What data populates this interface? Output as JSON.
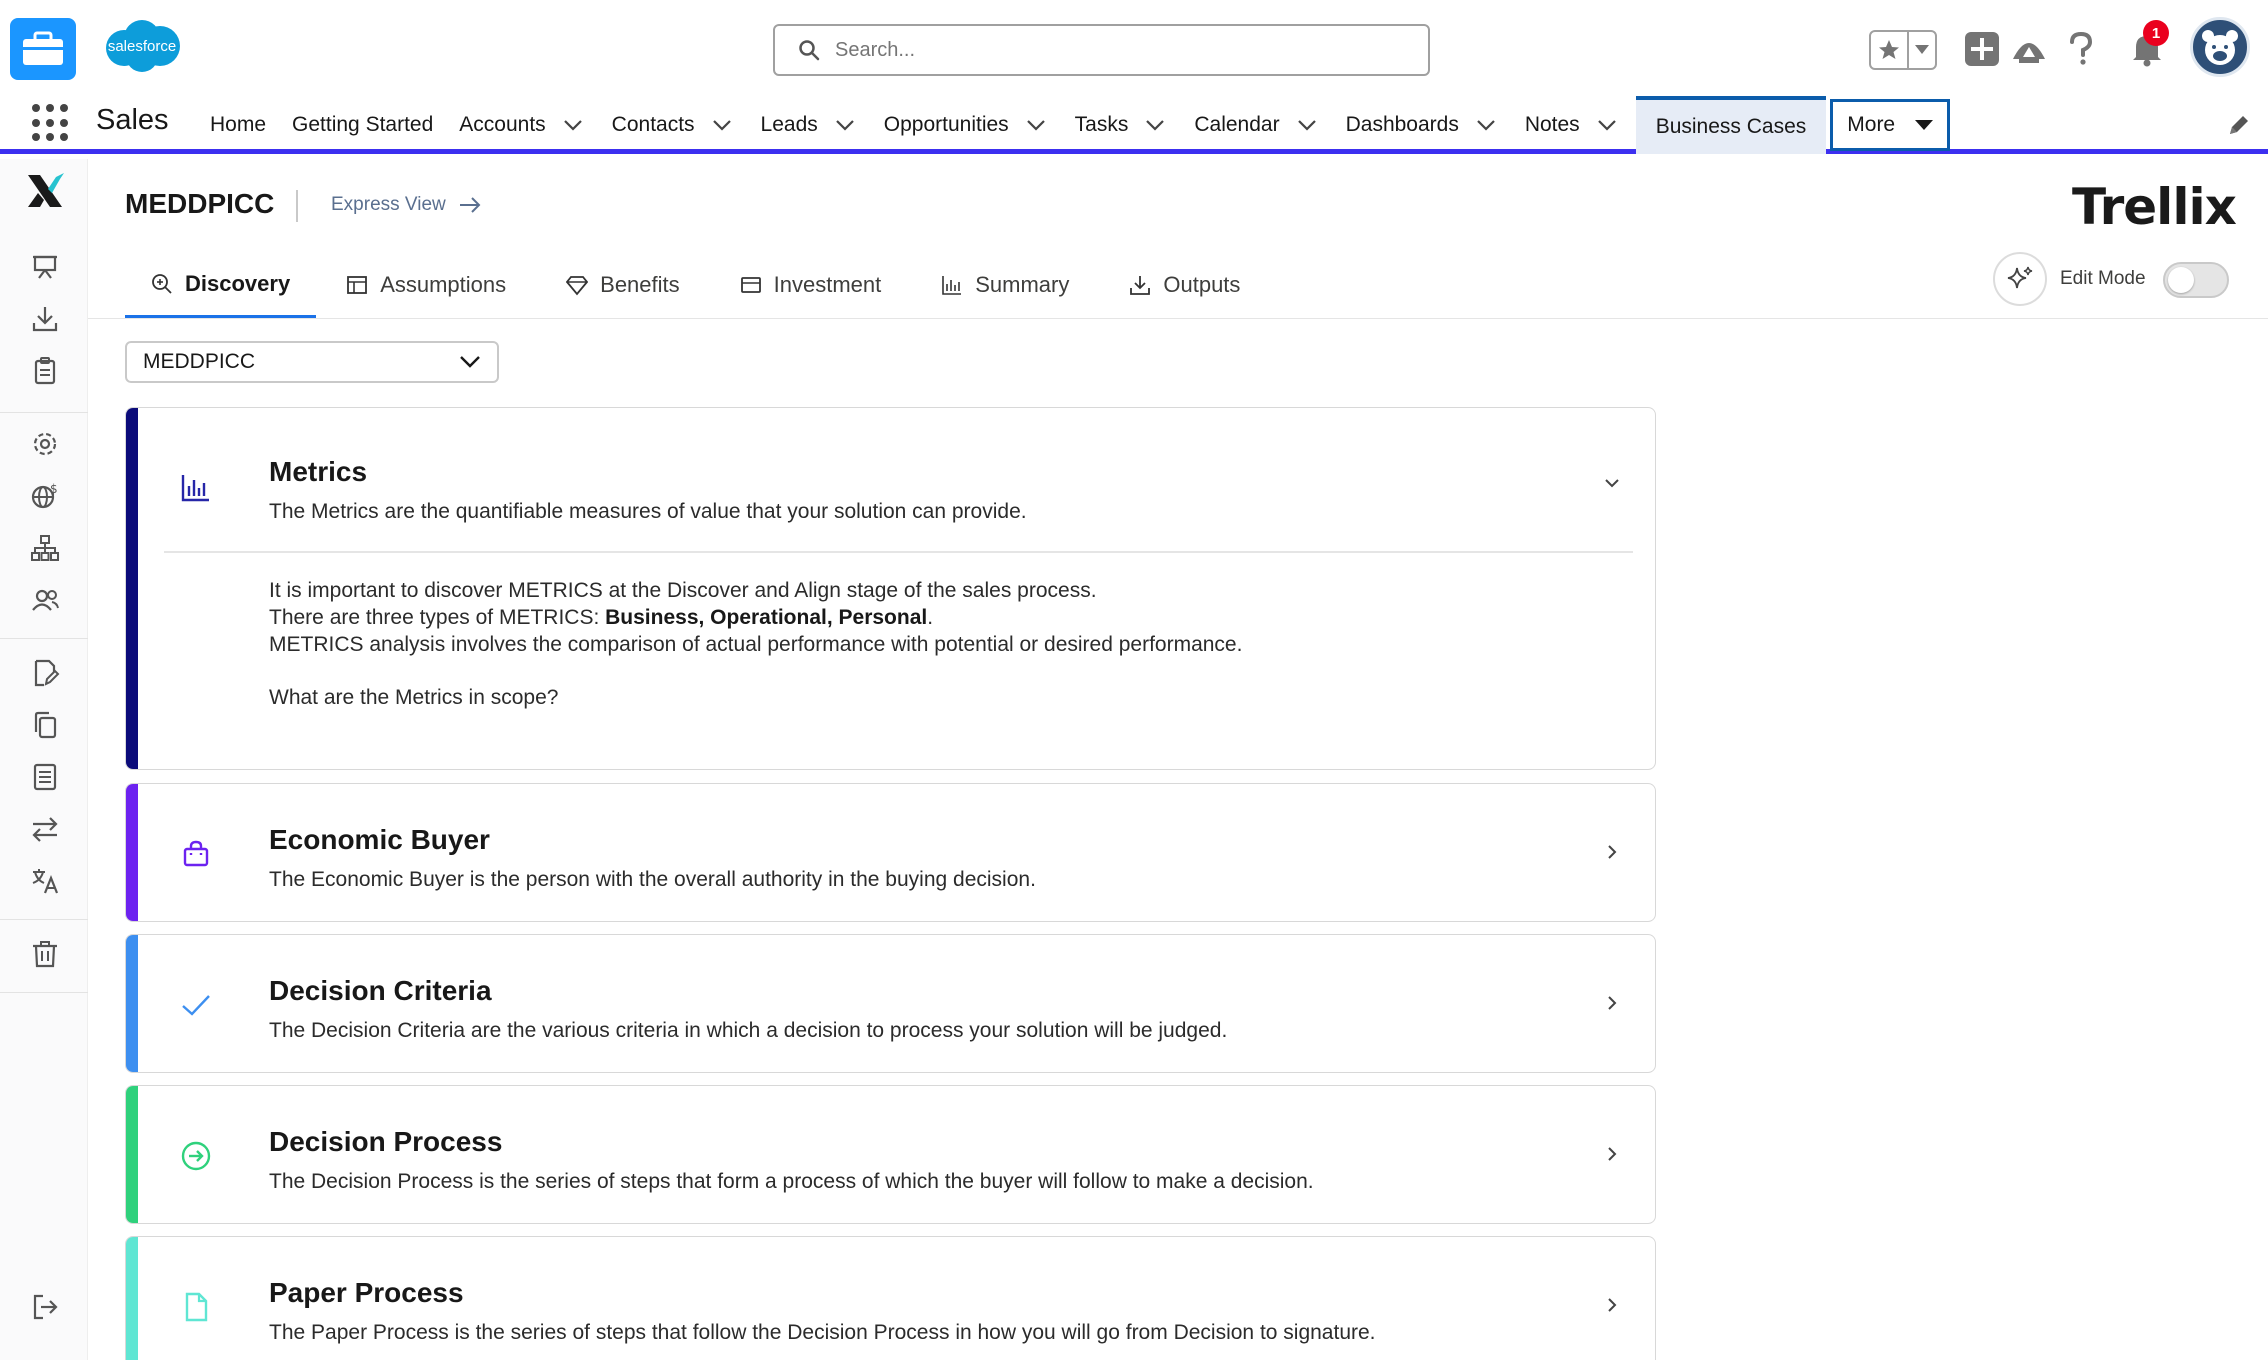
{
  "header": {
    "brand_small": "salesforce",
    "search_placeholder": "Search...",
    "notification_count": "1"
  },
  "nav": {
    "app_name": "Sales",
    "items": [
      {
        "label": "Home",
        "has_menu": false
      },
      {
        "label": "Getting Started",
        "has_menu": false
      },
      {
        "label": "Accounts",
        "has_menu": true
      },
      {
        "label": "Contacts",
        "has_menu": true
      },
      {
        "label": "Leads",
        "has_menu": true
      },
      {
        "label": "Opportunities",
        "has_menu": true
      },
      {
        "label": "Tasks",
        "has_menu": true
      },
      {
        "label": "Calendar",
        "has_menu": true
      },
      {
        "label": "Dashboards",
        "has_menu": true
      },
      {
        "label": "Notes",
        "has_menu": true
      }
    ],
    "active_item": "Business Cases",
    "more_label": "More"
  },
  "content": {
    "page_title": "MEDDPICC",
    "express_view_label": "Express View",
    "brand_logo_text": "Trell",
    "brand_logo_end": "ix",
    "tabs": [
      {
        "label": "Discovery",
        "icon": "magnifier-icon",
        "active": true
      },
      {
        "label": "Assumptions",
        "icon": "table-icon",
        "active": false
      },
      {
        "label": "Benefits",
        "icon": "diamond-icon",
        "active": false
      },
      {
        "label": "Investment",
        "icon": "card-icon",
        "active": false
      },
      {
        "label": "Summary",
        "icon": "bar-chart-icon",
        "active": false
      },
      {
        "label": "Outputs",
        "icon": "download-icon",
        "active": false
      }
    ],
    "edit_mode_label": "Edit Mode",
    "edit_mode_on": false,
    "framework_select": "MEDDPICC"
  },
  "cards": {
    "metrics": {
      "title": "Metrics",
      "desc": "The Metrics are the quantifiable measures of value that your solution can provide.",
      "body_line1": "It is important to discover METRICS at the Discover and Align stage of the sales process.",
      "body_line2_prefix": "There are three types of METRICS: ",
      "body_line2_bold": "Business, Operational, Personal",
      "body_line2_suffix": ".",
      "body_line3": "METRICS analysis involves the comparison of actual performance with potential or desired performance.",
      "body_question": "What are the Metrics in scope?",
      "accent": "#0b0b7a"
    },
    "economic_buyer": {
      "title": "Economic Buyer",
      "desc": "The Economic Buyer is the person with the overall authority in the buying decision.",
      "accent": "#6c22f0"
    },
    "decision_criteria": {
      "title": "Decision Criteria",
      "desc": "The Decision Criteria are the various criteria in which a decision to process your solution will be judged.",
      "accent": "#3d8ff0"
    },
    "decision_process": {
      "title": "Decision Process",
      "desc": "The Decision Process is the series of steps that form a process of which the buyer will follow to make a decision.",
      "accent": "#2fd17c"
    },
    "paper_process": {
      "title": "Paper Process",
      "desc": "The Paper Process is the series of steps that follow the Decision Process in how you will go from Decision to signature.",
      "accent": "#5fe6d3"
    }
  }
}
